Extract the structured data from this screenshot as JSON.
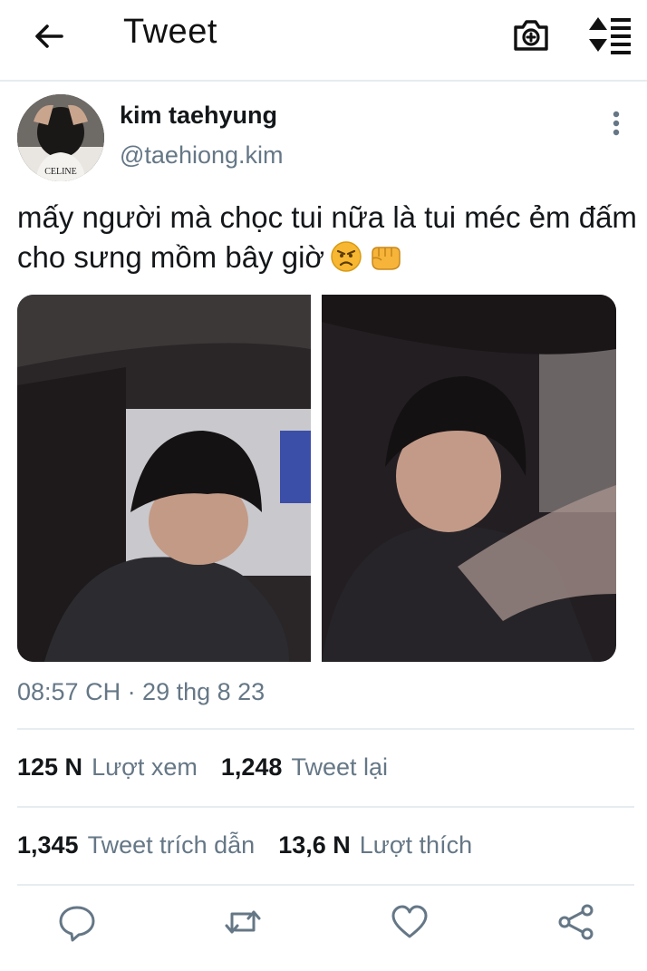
{
  "header": {
    "title": "Tweet"
  },
  "author": {
    "name": "kim taehyung",
    "handle": "@taehiong.kim",
    "shirt_text": "CELINE"
  },
  "tweet": {
    "text": "mấy người mà chọc tui nữa là tui méc ẻm đấm cho sưng mồm bây giờ",
    "emojis": [
      "angry-face",
      "fist"
    ],
    "timestamp": "08:57 CH · 29 thg 8 23"
  },
  "stats": {
    "views_value": "125 N",
    "views_label": "Lượt xem",
    "retweets_value": "1,248",
    "retweets_label": "Tweet lại",
    "quotes_value": "1,345",
    "quotes_label": "Tweet trích dẫn",
    "likes_value": "13,6 N",
    "likes_label": "Lượt thích"
  },
  "icons": {
    "back": "arrow-left-icon",
    "camera": "camera-plus-icon",
    "sort": "sort-icon",
    "more": "vertical-dots-icon",
    "reply": "reply-icon",
    "retweet": "retweet-icon",
    "like": "heart-icon",
    "share": "share-icon"
  },
  "colors": {
    "text": "#14171a",
    "secondary": "#657786",
    "divider": "#e6ecf0"
  }
}
